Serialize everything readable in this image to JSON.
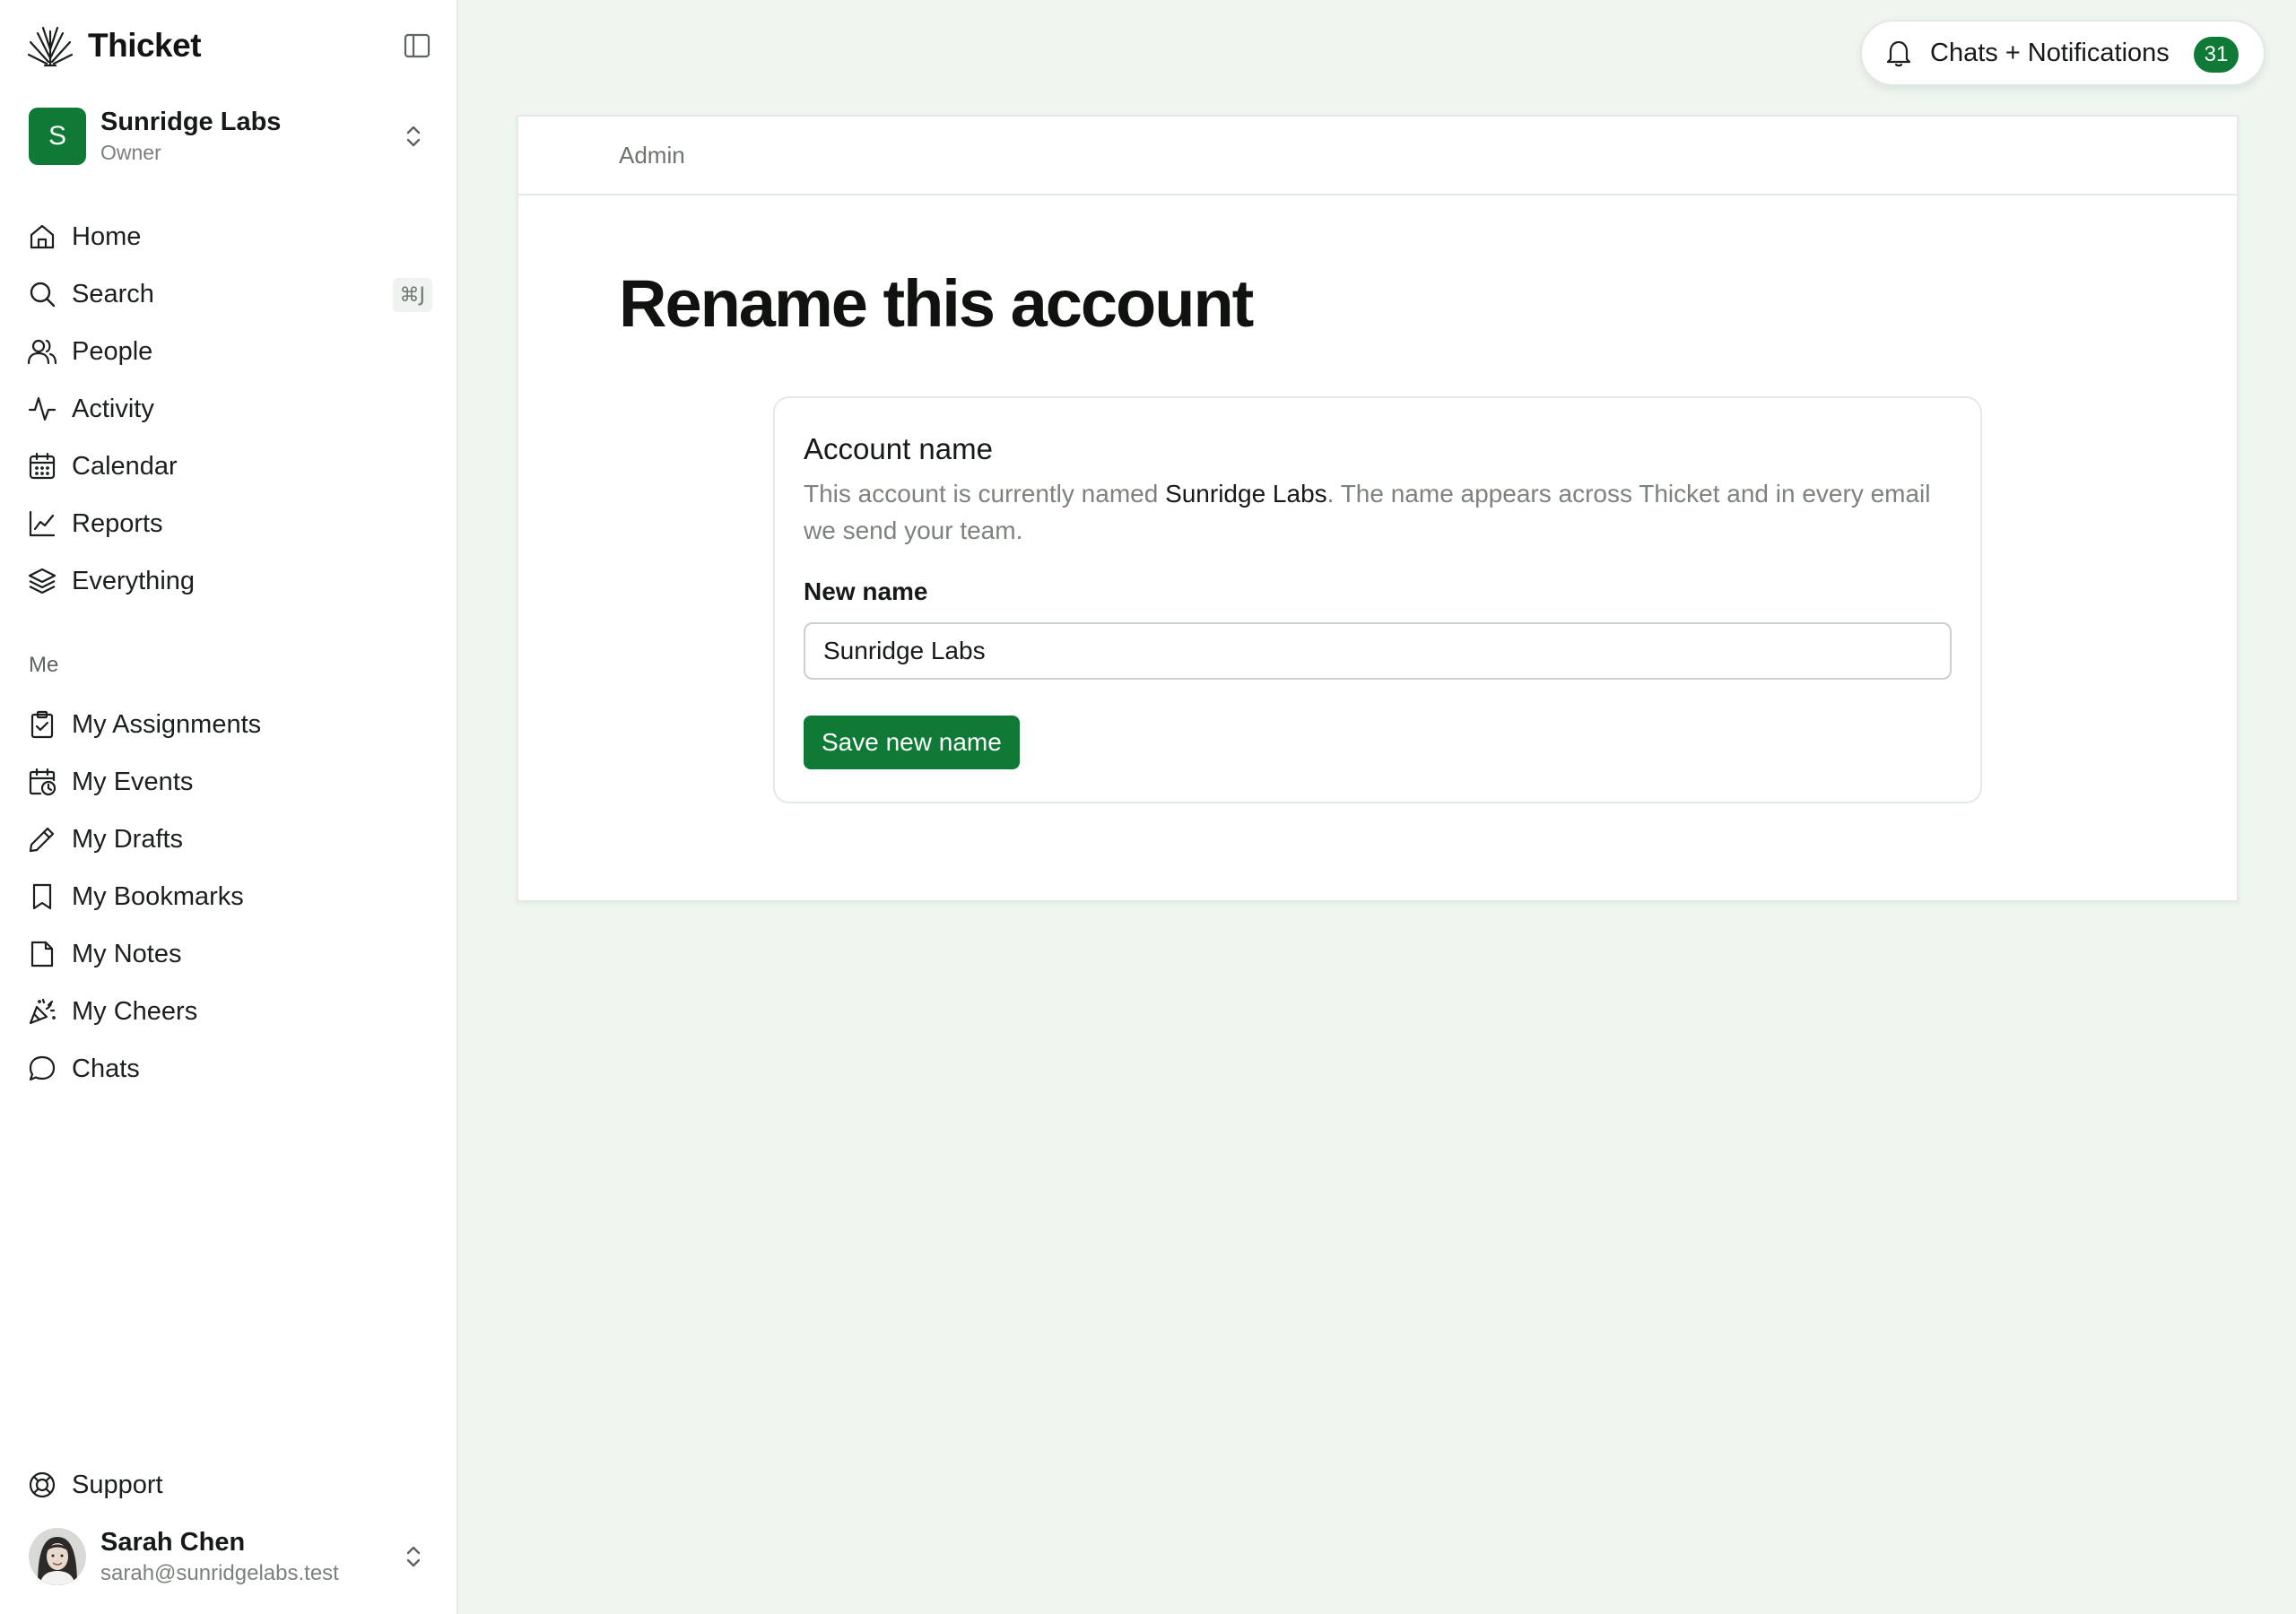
{
  "brand": {
    "name": "Thicket"
  },
  "account": {
    "initial": "S",
    "name": "Sunridge Labs",
    "role": "Owner"
  },
  "nav": {
    "items": [
      {
        "label": "Home",
        "icon": "home-icon"
      },
      {
        "label": "Search",
        "icon": "search-icon",
        "shortcut": "⌘J"
      },
      {
        "label": "People",
        "icon": "people-icon"
      },
      {
        "label": "Activity",
        "icon": "activity-icon"
      },
      {
        "label": "Calendar",
        "icon": "calendar-icon"
      },
      {
        "label": "Reports",
        "icon": "reports-icon"
      },
      {
        "label": "Everything",
        "icon": "layers-icon"
      }
    ],
    "me_label": "Me",
    "me_items": [
      {
        "label": "My Assignments",
        "icon": "clipboard-check-icon"
      },
      {
        "label": "My Events",
        "icon": "calendar-clock-icon"
      },
      {
        "label": "My Drafts",
        "icon": "pencil-icon"
      },
      {
        "label": "My Bookmarks",
        "icon": "bookmark-icon"
      },
      {
        "label": "My Notes",
        "icon": "note-icon"
      },
      {
        "label": "My Cheers",
        "icon": "party-popper-icon"
      },
      {
        "label": "Chats",
        "icon": "chat-bubble-icon"
      }
    ],
    "support": {
      "label": "Support",
      "icon": "lifebuoy-icon"
    }
  },
  "user": {
    "name": "Sarah Chen",
    "email": "sarah@sunridgelabs.test"
  },
  "notifications": {
    "label": "Chats + Notifications",
    "count": "31"
  },
  "main": {
    "breadcrumb": "Admin",
    "title": "Rename this account",
    "card": {
      "title": "Account name",
      "desc_prefix": "This account is currently named ",
      "desc_name": "Sunridge Labs",
      "desc_suffix": ". The name appears across Thicket and in every email we send your team.",
      "field_label": "New name",
      "input_value": "Sunridge Labs",
      "save_label": "Save new name"
    }
  },
  "colors": {
    "accent": "#0f7a36",
    "background": "#eef6ef"
  }
}
